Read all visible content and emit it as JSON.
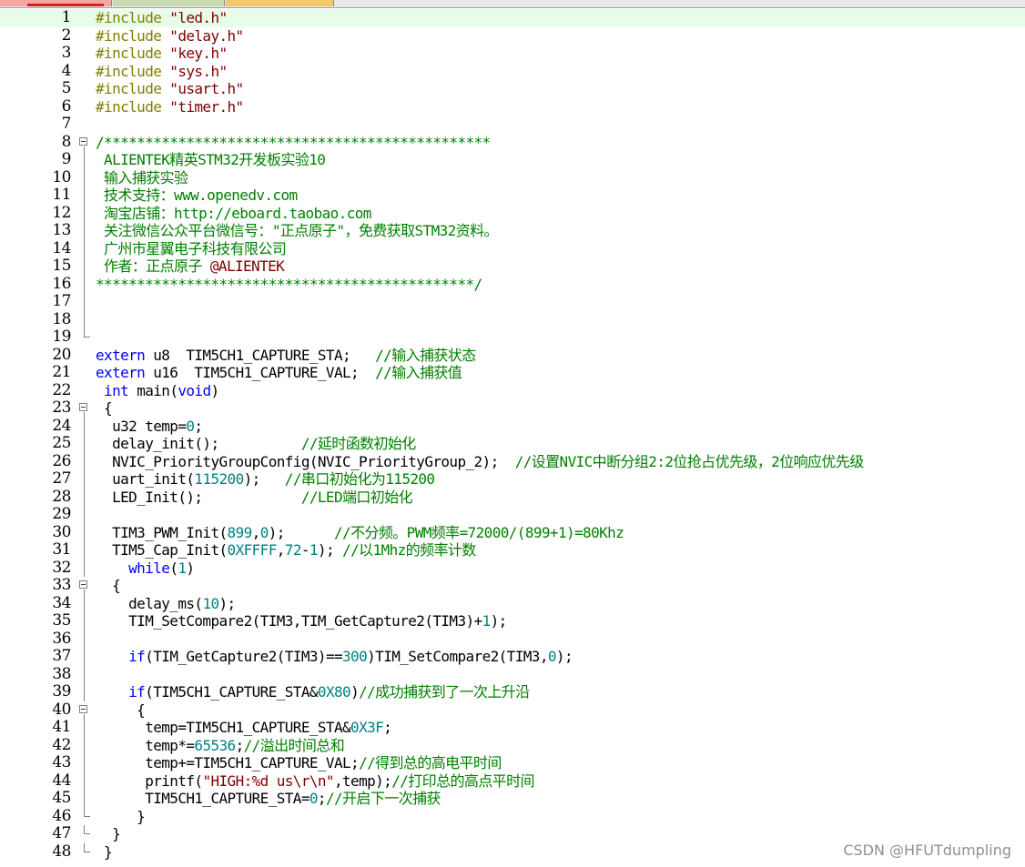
{
  "colors": {
    "plain": "#000000",
    "keyword": "#0000ff",
    "string": "#800000",
    "number": "#008080",
    "comment": "#008000",
    "preprocessor": "#808000",
    "current_line": "#e8fde9"
  },
  "tabs": [
    {
      "label": ""
    },
    {
      "label": ""
    },
    {
      "label": ""
    }
  ],
  "watermark": "CSDN @HFUTdumpling",
  "lines": [
    {
      "n": "1",
      "hl": true,
      "t": [
        [
          "pp",
          "#include "
        ],
        [
          "str",
          "\"led.h\""
        ]
      ]
    },
    {
      "n": "2",
      "t": [
        [
          "pp",
          "#include "
        ],
        [
          "str",
          "\"delay.h\""
        ]
      ]
    },
    {
      "n": "3",
      "t": [
        [
          "pp",
          "#include "
        ],
        [
          "str",
          "\"key.h\""
        ]
      ]
    },
    {
      "n": "4",
      "t": [
        [
          "pp",
          "#include "
        ],
        [
          "str",
          "\"sys.h\""
        ]
      ]
    },
    {
      "n": "5",
      "t": [
        [
          "pp",
          "#include "
        ],
        [
          "str",
          "\"usart.h\""
        ]
      ]
    },
    {
      "n": "6",
      "t": [
        [
          "pp",
          "#include "
        ],
        [
          "str",
          "\"timer.h\""
        ]
      ]
    },
    {
      "n": "7",
      "t": []
    },
    {
      "n": "8",
      "fold": "open",
      "t": [
        [
          "cm",
          "/***********************************************"
        ]
      ]
    },
    {
      "n": "9",
      "fold": "bar",
      "t": [
        [
          "cm",
          " ALIENTEK精英STM32开发板实验10"
        ]
      ]
    },
    {
      "n": "10",
      "fold": "bar",
      "t": [
        [
          "cm",
          " 输入捕获实验"
        ]
      ]
    },
    {
      "n": "11",
      "fold": "bar",
      "t": [
        [
          "cm",
          " 技术支持：www.openedv.com"
        ]
      ]
    },
    {
      "n": "12",
      "fold": "bar",
      "t": [
        [
          "cm",
          " 淘宝店铺：http://eboard.taobao.com"
        ]
      ]
    },
    {
      "n": "13",
      "fold": "bar",
      "t": [
        [
          "cm",
          " 关注微信公众平台微信号：\"正点原子\"，免费获取STM32资料。"
        ]
      ]
    },
    {
      "n": "14",
      "fold": "bar",
      "t": [
        [
          "cm",
          " 广州市星翼电子科技有限公司"
        ]
      ]
    },
    {
      "n": "15",
      "fold": "bar",
      "t": [
        [
          "cm",
          " 作者：正点原子 "
        ],
        [
          "str",
          "@ALIENTEK"
        ]
      ]
    },
    {
      "n": "16",
      "fold": "bar",
      "t": [
        [
          "cm",
          "**********************************************/"
        ]
      ]
    },
    {
      "n": "17",
      "fold": "bar",
      "t": []
    },
    {
      "n": "18",
      "fold": "bar",
      "t": []
    },
    {
      "n": "19",
      "fold": "end",
      "t": []
    },
    {
      "n": "20",
      "t": [
        [
          "kw",
          "extern "
        ],
        [
          "0",
          "u8  TIM5CH1_CAPTURE_STA;   "
        ],
        [
          "cm",
          "//输入捕获状态"
        ]
      ]
    },
    {
      "n": "21",
      "t": [
        [
          "kw",
          "extern "
        ],
        [
          "0",
          "u16  TIM5CH1_CAPTURE_VAL;  "
        ],
        [
          "cm",
          "//输入捕获值"
        ]
      ]
    },
    {
      "n": "22",
      "t": [
        [
          "0",
          " "
        ],
        [
          "kw",
          "int "
        ],
        [
          "0",
          "main("
        ],
        [
          "kw",
          "void"
        ],
        [
          "0",
          ")"
        ]
      ]
    },
    {
      "n": "23",
      "fold": "open",
      "t": [
        [
          "0",
          " {"
        ]
      ]
    },
    {
      "n": "24",
      "fold": "bar",
      "t": [
        [
          "0",
          "  u32 temp="
        ],
        [
          "num",
          "0"
        ],
        [
          "0",
          ";"
        ]
      ]
    },
    {
      "n": "25",
      "fold": "bar",
      "t": [
        [
          "0",
          "  delay_init();          "
        ],
        [
          "cm",
          "//延时函数初始化"
        ]
      ]
    },
    {
      "n": "26",
      "fold": "bar",
      "t": [
        [
          "0",
          "  NVIC_PriorityGroupConfig(NVIC_PriorityGroup_2);  "
        ],
        [
          "cm",
          "//设置NVIC中断分组2:2位抢占优先级，2位响应优先级"
        ]
      ]
    },
    {
      "n": "27",
      "fold": "bar",
      "t": [
        [
          "0",
          "  uart_init("
        ],
        [
          "num",
          "115200"
        ],
        [
          "0",
          ");   "
        ],
        [
          "cm",
          "//串口初始化为115200"
        ]
      ]
    },
    {
      "n": "28",
      "fold": "bar",
      "t": [
        [
          "0",
          "  LED_Init();            "
        ],
        [
          "cm",
          "//LED端口初始化"
        ]
      ]
    },
    {
      "n": "29",
      "fold": "bar",
      "t": []
    },
    {
      "n": "30",
      "fold": "bar",
      "t": [
        [
          "0",
          "  TIM3_PWM_Init("
        ],
        [
          "num",
          "899"
        ],
        [
          "0",
          ","
        ],
        [
          "num",
          "0"
        ],
        [
          "0",
          ");      "
        ],
        [
          "cm",
          "//不分频。PWM频率=72000/(899+1)=80Khz"
        ]
      ]
    },
    {
      "n": "31",
      "fold": "bar",
      "t": [
        [
          "0",
          "  TIM5_Cap_Init("
        ],
        [
          "num",
          "0XFFFF"
        ],
        [
          "0",
          ","
        ],
        [
          "num",
          "72"
        ],
        [
          "0",
          "-"
        ],
        [
          "num",
          "1"
        ],
        [
          "0",
          "); "
        ],
        [
          "cm",
          "//以1Mhz的频率计数"
        ]
      ]
    },
    {
      "n": "32",
      "fold": "bar",
      "t": [
        [
          "0",
          "    "
        ],
        [
          "kw",
          "while"
        ],
        [
          "0",
          "("
        ],
        [
          "num",
          "1"
        ],
        [
          "0",
          ")"
        ]
      ]
    },
    {
      "n": "33",
      "fold": "open",
      "t": [
        [
          "0",
          "  {"
        ]
      ]
    },
    {
      "n": "34",
      "fold": "bar",
      "t": [
        [
          "0",
          "    delay_ms("
        ],
        [
          "num",
          "10"
        ],
        [
          "0",
          ");"
        ]
      ]
    },
    {
      "n": "35",
      "fold": "bar",
      "t": [
        [
          "0",
          "    TIM_SetCompare2(TIM3,TIM_GetCapture2(TIM3)+"
        ],
        [
          "num",
          "1"
        ],
        [
          "0",
          ");"
        ]
      ]
    },
    {
      "n": "36",
      "fold": "bar",
      "t": []
    },
    {
      "n": "37",
      "fold": "bar",
      "t": [
        [
          "0",
          "    "
        ],
        [
          "kw",
          "if"
        ],
        [
          "0",
          "(TIM_GetCapture2(TIM3)=="
        ],
        [
          "num",
          "300"
        ],
        [
          "0",
          ")TIM_SetCompare2(TIM3,"
        ],
        [
          "num",
          "0"
        ],
        [
          "0",
          ");"
        ]
      ]
    },
    {
      "n": "38",
      "fold": "bar",
      "t": []
    },
    {
      "n": "39",
      "fold": "bar",
      "t": [
        [
          "0",
          "    "
        ],
        [
          "kw",
          "if"
        ],
        [
          "0",
          "(TIM5CH1_CAPTURE_STA&"
        ],
        [
          "num",
          "0X80"
        ],
        [
          "0",
          ")"
        ],
        [
          "cm",
          "//成功捕获到了一次上升沿"
        ]
      ]
    },
    {
      "n": "40",
      "fold": "open",
      "t": [
        [
          "0",
          "     {"
        ]
      ]
    },
    {
      "n": "41",
      "fold": "bar",
      "t": [
        [
          "0",
          "      temp=TIM5CH1_CAPTURE_STA&"
        ],
        [
          "num",
          "0X3F"
        ],
        [
          "0",
          ";"
        ]
      ]
    },
    {
      "n": "42",
      "fold": "bar",
      "t": [
        [
          "0",
          "      temp*="
        ],
        [
          "num",
          "65536"
        ],
        [
          "0",
          ";"
        ],
        [
          "cm",
          "//溢出时间总和"
        ]
      ]
    },
    {
      "n": "43",
      "fold": "bar",
      "t": [
        [
          "0",
          "      temp+=TIM5CH1_CAPTURE_VAL;"
        ],
        [
          "cm",
          "//得到总的高电平时间"
        ]
      ]
    },
    {
      "n": "44",
      "fold": "bar",
      "t": [
        [
          "0",
          "      printf("
        ],
        [
          "str",
          "\"HIGH:%d us\\r\\n\""
        ],
        [
          "0",
          ",temp);"
        ],
        [
          "cm",
          "//打印总的高点平时间"
        ]
      ]
    },
    {
      "n": "45",
      "fold": "bar",
      "t": [
        [
          "0",
          "      TIM5CH1_CAPTURE_STA="
        ],
        [
          "num",
          "0"
        ],
        [
          "0",
          ";"
        ],
        [
          "cm",
          "//开启下一次捕获"
        ]
      ]
    },
    {
      "n": "46",
      "fold": "end",
      "t": [
        [
          "0",
          "     }"
        ]
      ]
    },
    {
      "n": "47",
      "fold": "end",
      "t": [
        [
          "0",
          "  }"
        ]
      ]
    },
    {
      "n": "48",
      "fold": "end",
      "t": [
        [
          "0",
          " }"
        ]
      ]
    }
  ]
}
